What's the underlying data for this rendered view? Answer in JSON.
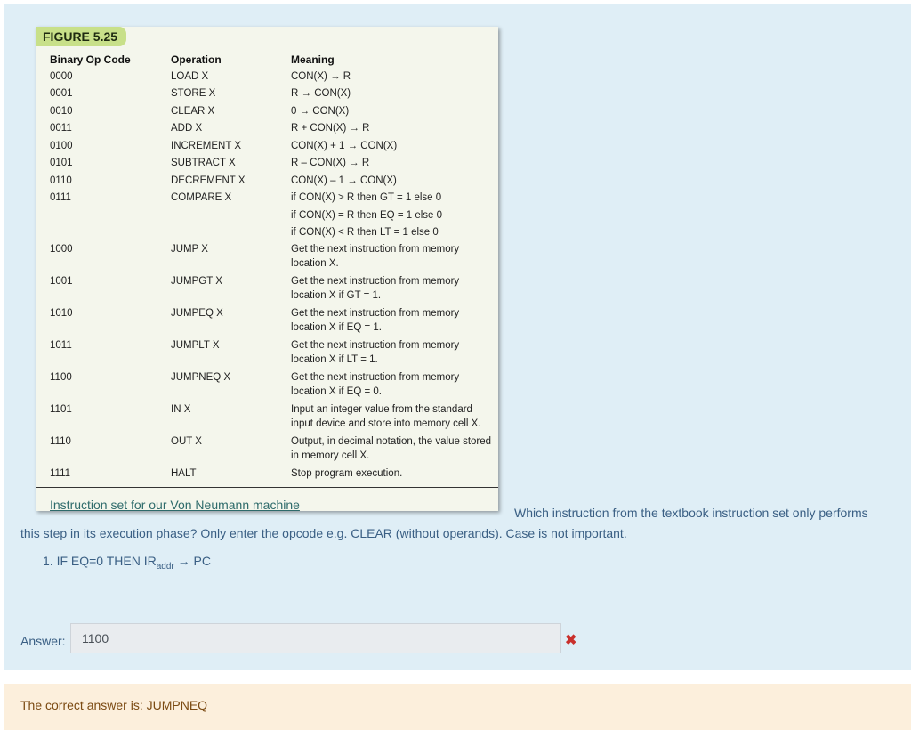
{
  "figure": {
    "tag": "FIGURE 5.25",
    "headers": {
      "code": "Binary Op Code",
      "operation": "Operation",
      "meaning": "Meaning"
    },
    "rows": [
      {
        "code": "0000",
        "op": "LOAD X",
        "meaning": "CON(X) → R"
      },
      {
        "code": "0001",
        "op": "STORE X",
        "meaning": "R → CON(X)"
      },
      {
        "code": "0010",
        "op": "CLEAR X",
        "meaning": "0 → CON(X)"
      },
      {
        "code": "0011",
        "op": "ADD X",
        "meaning": "R + CON(X) → R"
      },
      {
        "code": "0100",
        "op": "INCREMENT X",
        "meaning": "CON(X) + 1 → CON(X)"
      },
      {
        "code": "0101",
        "op": "SUBTRACT X",
        "meaning": "R – CON(X) → R"
      },
      {
        "code": "0110",
        "op": "DECREMENT X",
        "meaning": "CON(X) – 1 → CON(X)"
      },
      {
        "code": "0111",
        "op": "COMPARE X",
        "meaning": "if CON(X) > R then GT = 1 else 0"
      },
      {
        "code": "",
        "op": "",
        "meaning": "if CON(X) = R then EQ = 1 else 0"
      },
      {
        "code": "",
        "op": "",
        "meaning": "if CON(X) < R then LT = 1 else 0"
      },
      {
        "code": "1000",
        "op": "JUMP X",
        "meaning": "Get the next instruction from memory location X."
      },
      {
        "code": "1001",
        "op": "JUMPGT X",
        "meaning": "Get the next instruction from memory location X if GT = 1."
      },
      {
        "code": "1010",
        "op": "JUMPEQ X",
        "meaning": "Get the next instruction from memory location X if EQ = 1."
      },
      {
        "code": "1011",
        "op": "JUMPLT X",
        "meaning": "Get the next instruction from memory location X if LT = 1."
      },
      {
        "code": "1100",
        "op": "JUMPNEQ X",
        "meaning": "Get the next instruction from memory location X if EQ = 0."
      },
      {
        "code": "1101",
        "op": "IN X",
        "meaning": "Input an integer value from the standard input device and store into memory cell X."
      },
      {
        "code": "1110",
        "op": "OUT X",
        "meaning": "Output, in decimal notation, the value stored in memory cell X."
      },
      {
        "code": "1111",
        "op": "HALT",
        "meaning": "Stop program execution."
      }
    ],
    "caption": "Instruction set for our Von Neumann machine"
  },
  "question": {
    "line1": "Which instruction from the textbook instruction set only performs",
    "line2": "this step in its execution phase? Only enter the opcode e.g. CLEAR (without operands). Case is not important.",
    "step_prefix": "1. IF EQ=0 THEN IR",
    "step_sub": "addr",
    "step_suffix": " → PC"
  },
  "answer": {
    "label": "Answer:",
    "value": "1100",
    "status_icon": "cross-icon",
    "status_color": "#c9302c"
  },
  "feedback": {
    "text": "The correct answer is: JUMPNEQ"
  }
}
